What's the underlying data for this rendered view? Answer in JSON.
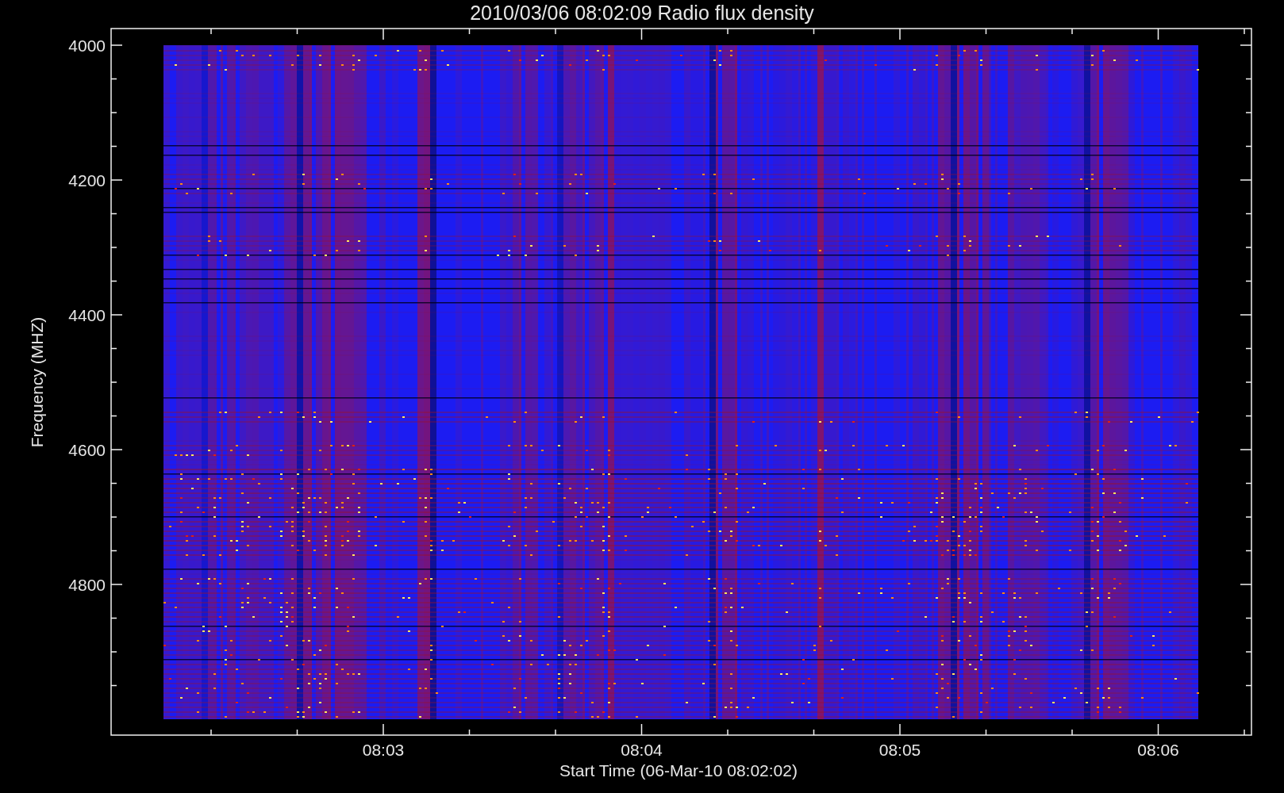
{
  "plot": {
    "title": "2010/03/06 08:02:09 Radio flux density",
    "ylabel": "Frequency (MHZ)",
    "xlabel": "Start Time (06-Mar-10 08:02:02)",
    "yticks": [
      "4000",
      "4200",
      "4400",
      "4600",
      "4800"
    ],
    "xticks": [
      "08:03",
      "08:04",
      "08:05",
      "08:06"
    ]
  }
}
